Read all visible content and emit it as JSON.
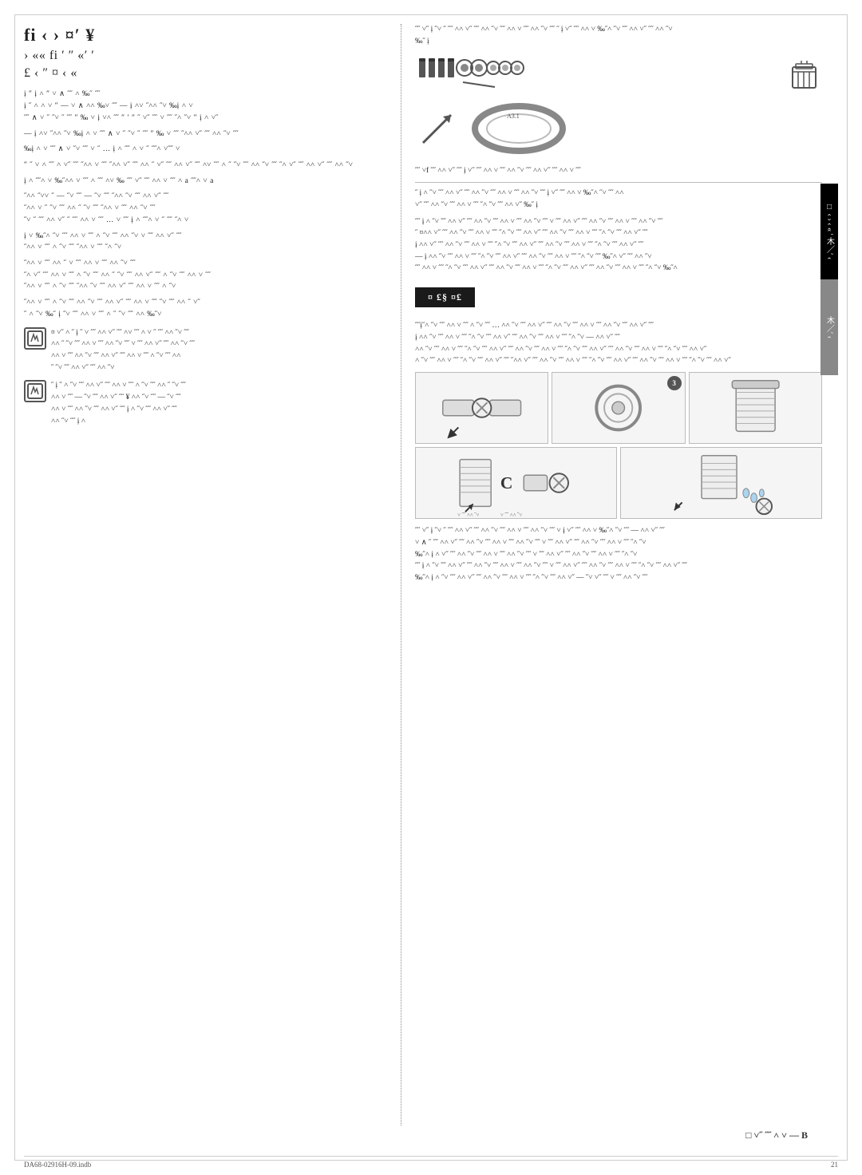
{
  "page": {
    "border": true,
    "footer": {
      "file": "DA68-02916H-09.indb",
      "page_number": "21"
    },
    "side_tab_black": "□ ‹ › ‹ « ′ 木／′ ‹",
    "b_label": "B"
  },
  "left": {
    "title": {
      "line1": "fi ‹ › ¤′ ¥",
      "line2": "› «« fi ′ ″ «′ ′",
      "line3": "£ ‹ ″ ¤ ‹ «"
    },
    "paragraphs": [
      "ị ″ ị ˄ ″ ˅ ∧ ˝˝ ˄ ‰˝ ˝˝ ị ˝ ˄ ˄ ˅ ″ — ˅ ∧ ˄˄ ‰˅ ˝˝ — ị ˄˅ ˝˄˄ ˝˅ ‰ị ˄ ˅ ˝˝ ∧ ˅ ˝ ˝˅ ˝ ˝˝ ″ ‰ ˅ ị ˅˄ ˝˝ ″ ′ ″ ˝ ˅˝ ˝˝ ˅ ˝˝ ˝˄ ˝˅ ″ ị ˄ ˅˝",
      "˝˄˄ ˅ ˄˝ ˝″ ‰ị ˄ ˅ ˝ ˅ ″˝ ˝˝ ˅ ˝″ ˝˝ ˄˄ ˄ ˝ ˅˝ ˝ ˝˝ ˄˄ ‰ ˅ ˝˝ ˄ ″ ˅˝ ˝˝ ˄ ˅˝ ˝˝",
      "˝˄˅ ị ˝˝ ˝ ″ ˝ ˅ … ị ˝ ˄ ˝˝˄ ˅ ˝ ˝˝˄ ˅",
      "˅ ˝ ˝˝ ˄ ˝˅ ˝ ˝″ ‰ị ˄˄ ˅ ˅˝ ˝˝ ˄˝ ˝ ˄˄ ˅˅ ˝ ˝˝ ˝˅ ˄˄ ˝˅ ˝˝ ˄˄ ˝˅ ˝˝ ˄˄ ˅˝ ˝˝",
      "ị ˄ ˝˝˄ ˅ ‰˝˄˄ ˅ ˝˝ ˄ ˝˝ ˄˅ ‰ ˝˝ ˅˝ ˝˝ ˄˄ ˅ ˝˝ ˄ a ˝˝˄ ˅ a",
      "˝˄˄ ˝˅˅ ˝ — ˝˅ ˝˝ — ˝˅ ˝˝ ˝˄˄ ˝˅ ˝˝ ˄˄ ˅˝ ˝˝",
      "˝˄˄ ˅ ˝ ˝˅ ˝˝ ˄˄ ˝ ˝˅ ˝˝ ˝˄˄ ˅ ˝˝ ˄˄ ˝˅ ˝˝",
      "˝˅ ˝ ˝˝ ˄˄ ˅˝ ˝ ˝˝ ˄˄ ˅ ˝˝ … ˅ ˝˝ ị ˄ ˝˝˄ ˅ ˝ ˝˝ ˝˄ ˅",
      "ị ˅ ‰˝˄ ˝˅ ˝˝ ˄˄ ˅ ˝˝ ˄ ˝˅ ˝˝ ˄˄ ˝˅ ˅ ˝˝ ˄˄ ˅˝ ˝˝",
      "˝˄˄ ˅ ˝˝ ˄ ˝˅ ˝˝ ˝˄˄ ˅ ˝˝ ˝˄ ˝˅",
      "˝˄˄ ˅ ˝˝ ˄˄ ˝ ˅ ˝˝ ˄˄ ˅ ˝˝ ˄˄ ˝˅ ˝˝",
      "˝˄ ˅˝ ˝˝ ˄˄ ˅ ˝˝ ˄ ˝˅ ˝˝ ˄˄ ˝ ˝˅ ˝˝ ˄˄ ˅˝ ˝˝ ˄ ˝˅ ˝˝ ˄˄ ˅ ˝˝",
      "˝˄˄ ˅ ˝˝ ˄ ˝˅ ˝˝ ˝˄˄ ˝˅ ˝˝ ˄˄ ˅˝ ˝˝ ˄˄ ˅ ˝˝ ˄ ˝˅",
      "˝˄˄ ˅ ˝˝ ˄ ˝˅ ˝˝ ˄˄ ˝˅ ˝˝ ˄˄ ˅˝ ˝˝ ˄˄ ˅ ˝˝ ˝˅ ˝˝ ˄˄ ˝ ˅˝",
      "˝ ˄ ˝˅ ‰˝ ị ˝˅ ˝˝ ˄˄ ˅ ˝˝ ˄ ˝ ˝˅ ˝˝ ˄˄ ‰˝˅"
    ],
    "note1": {
      "icon": "✎",
      "text": "¤ ˅˝ ˄ ˝ ị ˝ ˅ ˝˝ ˄˄ ˅˝ ˝˝ ˄˅ ˝˝ ˄ ˅ ˝ ˝˝ ˄˄ ˝˅ ˝˝ ˄˄ ˝ ˝˅ ˝˝ ˄˄ ˅ ˝˝ ˄˄ ˝˅ ˝˝ ˅ ˝˝ ˄˄ ˅˝ ˝˝ ˄˄ ˝˅ ˝˝"
    },
    "note2": {
      "icon": "✎",
      "text": "˝ ị ˝ ˄ ˝˅ ˝˝ ˄˄ ˅˝ ˝˝ ˄˄ ˅ ˝˝ ˄ ˝˅ ˝˝ ˄˄ ˝ ˝˅ ˝˝ ˄˄ ˅ ˝˝ — ˝˅ ˝˝ ˄˄ ˅˝ ˝˝ ¥ ˄˄ ˝˅ ˝˝ — ˝˅ ˝˝ ˄˄ ˅ ˝˝ ˄˄ ˝˅ ˝˝ ˄˄ ˅˝ ˝˝ ị ˄"
    }
  },
  "right": {
    "top_text": "˝˝ ˅˝ ị ˝˅ ˝ ˝˝ ˄˄ ˅˝ ˝˝ ˄˄ ˝˅ ˝˝ ˄˄ ˅ ˝˝ ˄˄ ˝˅ ˝˝ ˝ ị ˅˝ ˝˝ ˄˄ ˅ ‰˝˄ ˝˅ ˝˝ ˄˄ ˅˝ ˝˝ ˄˄ ˝˅ ˝˝ ˄˄ ˅ ˝˝ ˝˄ ˝˅ ˝˝ ˄˄ ˅˝ ‰˝ ị",
    "parts_label": "Parts icons",
    "basket_label": "Basket icon",
    "ring_label": "Ring/gasket diagram",
    "arrow_label": "Installation arrow",
    "mid_text1": "˝˝ ˅f ˝˝ ˄˄ ˅˝ ˝˝ ị ˅˝ ˝˝ ˄˄ ˅ ˝˝ ˄˄ ˝˅ ˝˝ ˄˄ ˅˝ ˝˝ ˄˄ ˅ ˝˝",
    "section_title": "˝ ˄˄ ˅˝ ˝˝ ˄˄ ˅ ˝˝ ˄˄ ˝˅ ˝˝ ˄˄ ˅˝ ˝˝ ˄˄ ˝˅",
    "section_text1": "˝˝ ị ˄ ˝˅ ˝˝ ˄˄ ˅˝ ˝˝ ˄˄ ˝˅ ˝˝ ˄˄ ˅ ˝˝ ˄˄ ˝˅ ˝˝ ˅ ˝˝ ˄˄ ˅˝ ˝˝ ˄˄ ˝˅ ˝˝ ˄˄ ˅ ˝˝ ˄˄ ˝˅ ˝˝",
    "caution_label": "¤ £§ ¤£",
    "caution_steps": "˝˝ị˝˄ ˝˅ ˝˝ ˄˄ ˅ ˝˝ ˄ ˝˅ ˝˝ … ˄˄ ˝˅ ˝˝ ˄˄ ˅˝ ˝˝ ˄˄ ˝˅ ˝˝ ˄˄ ˅ ˝˝ ˄˄ ˝˅ ˝˝ ˄˄ ˅˝ ˝˝ ˄˄ ˝˅ ˝˝ ˄˄ ˅ ˝˝ ˄˄ ˝˅ ˝˝ ˄˄ ˅˝ ˝˝",
    "steps": [
      {
        "label": "Step 1 - wrench connection",
        "badge": ""
      },
      {
        "label": "Step 3 - circular component",
        "badge": "3"
      },
      {
        "label": "Step - filter component",
        "badge": ""
      }
    ],
    "steps_bottom": [
      {
        "label": "Step - C connector",
        "badge": ""
      },
      {
        "label": "Step - water drops",
        "badge": ""
      }
    ],
    "bottom_text": "˝˝ ˅˝ ị ˝˅ ˝ ˝˝ ˄˄ ˅˝ ˝˝ ˄˄ ˝˅ ˝˝ ˄˄ ˅ ˝˝ ˄˄ ˝˅ ˝˝ ˅ ị ˅˝ ˝˝ ˄˄ ˅ ‰˝˄ ˝˅ ˝˝ ˄˄ ˅˝ ˝˝ ˄˄ ˝˅ ˝˝ ˄˄ ˅ ˝˝ ˝˄ ˝˅ ˝˝ ˄˄ ˅˝ ˝˝ ị ˝˅ ˝˝ ˄˄ ˅ ˝˝ ˄˄ ˝˅ ˝˝ ˄˄ ˅˝ ˝˝ ˄˄ ˅ ˝˝ ˄˄ ˝˅ ˝˝ ˄˄ ˅˝ ˝˝ ˄˄ ˝˅"
  },
  "footer": {
    "filename": "DA68-02916H-09.indb",
    "page": "21",
    "bottom_right": "□ ˅˝ ˝˝ ˄ ˅ — B"
  }
}
